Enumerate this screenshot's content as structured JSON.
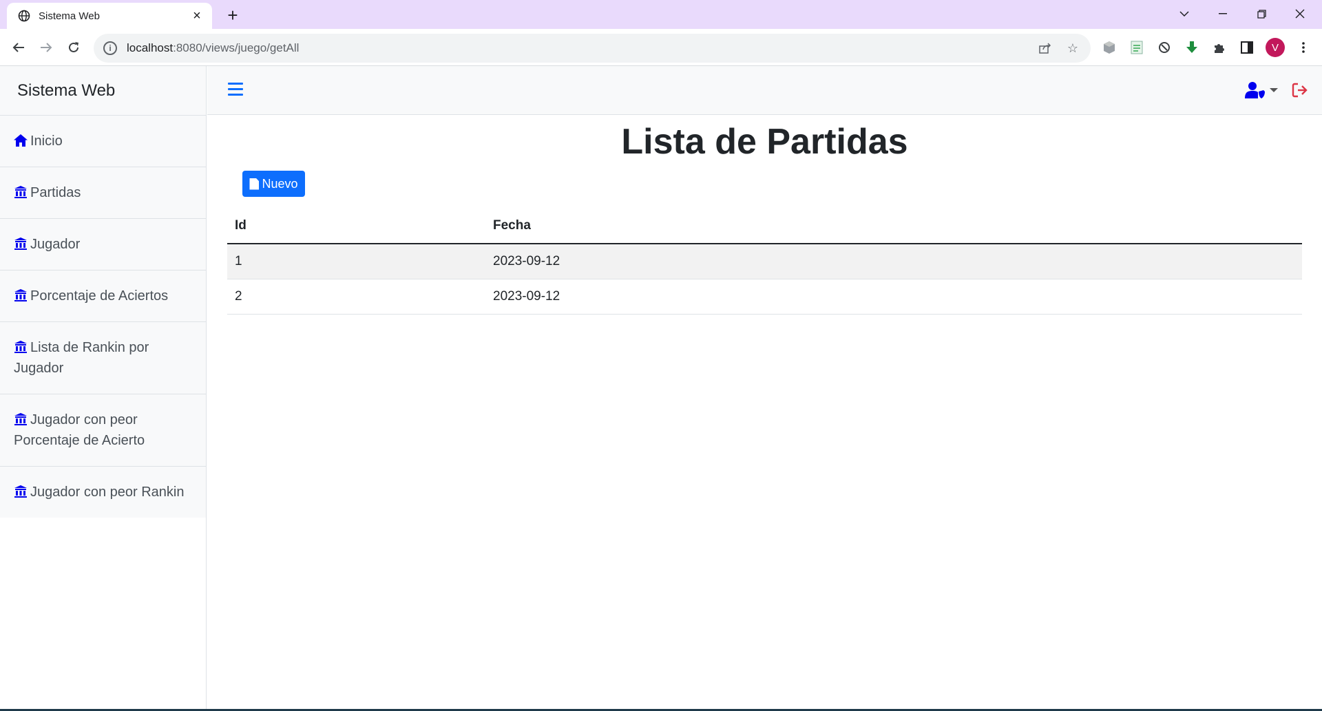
{
  "browser": {
    "tab_title": "Sistema Web",
    "url_host": "localhost",
    "url_rest": ":8080/views/juego/getAll",
    "avatar_letter": "V",
    "colors": {
      "tabbar": "#e9dafc",
      "avatar": "#c2185b"
    }
  },
  "sidebar": {
    "brand": "Sistema Web",
    "items": [
      {
        "label": "Inicio",
        "icon": "home-icon"
      },
      {
        "label": "Partidas",
        "icon": "building-icon"
      },
      {
        "label": "Jugador",
        "icon": "building-icon"
      },
      {
        "label": "Porcentaje de Aciertos",
        "icon": "building-icon"
      },
      {
        "label": "Lista de Rankin por Jugador",
        "icon": "building-icon"
      },
      {
        "label": "Jugador con peor Porcentaje de Acierto",
        "icon": "building-icon"
      },
      {
        "label": "Jugador con peor Rankin",
        "icon": "building-icon"
      }
    ]
  },
  "main": {
    "title": "Lista de Partidas",
    "new_button": "Nuevo",
    "table": {
      "headers": [
        "Id",
        "Fecha"
      ],
      "rows": [
        [
          "1",
          "2023-09-12"
        ],
        [
          "2",
          "2023-09-12"
        ]
      ]
    }
  },
  "colors": {
    "primary": "#0d6efd",
    "icon_blue": "#0000ee",
    "logout": "#dc3545"
  }
}
